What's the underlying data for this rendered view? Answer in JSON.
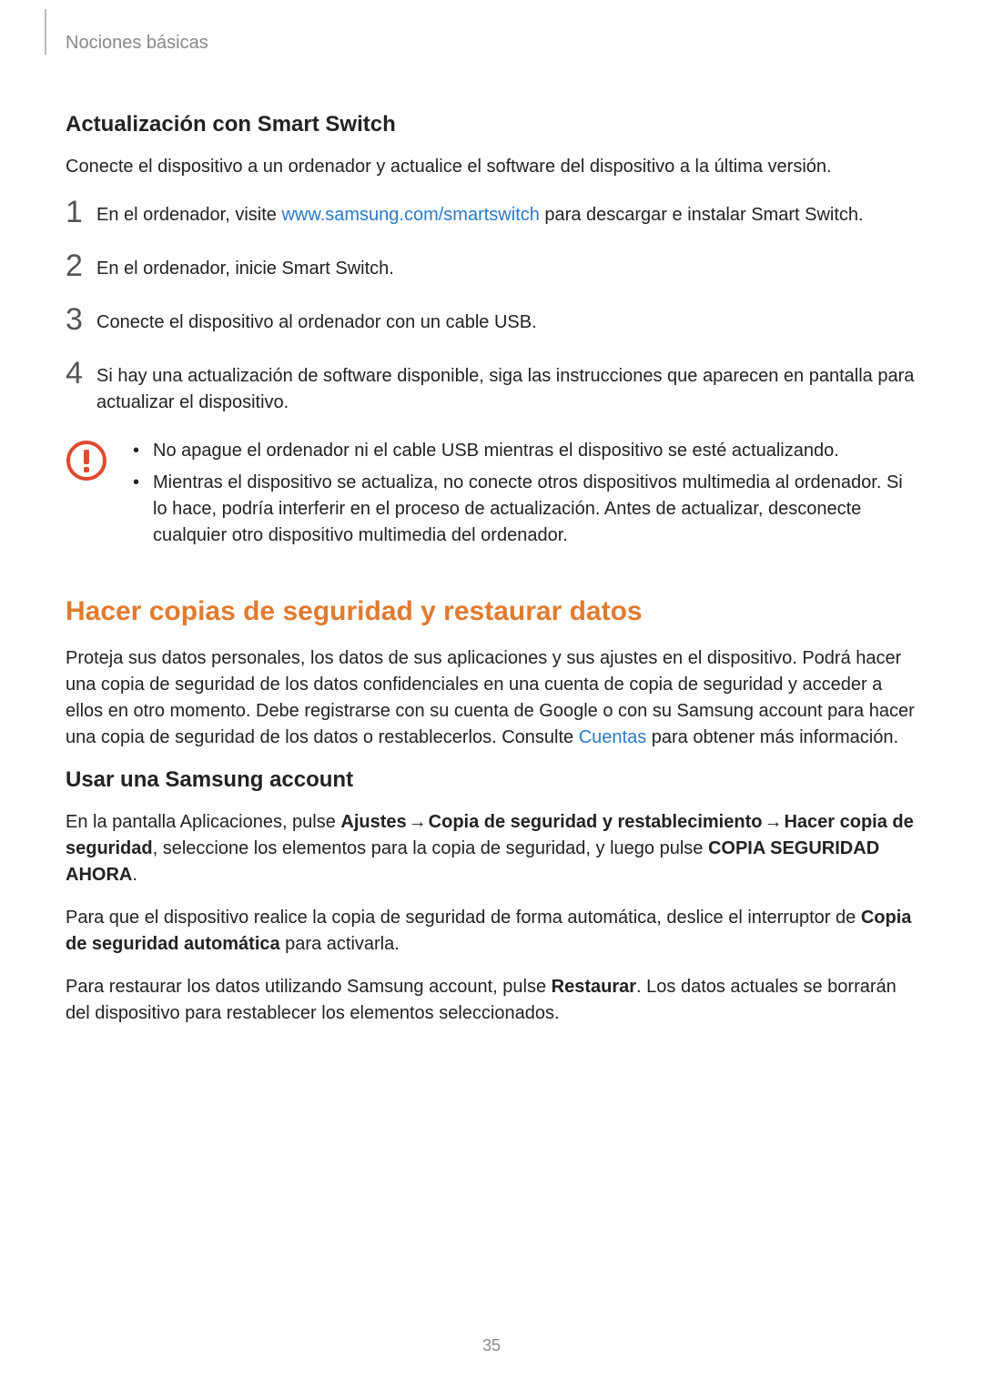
{
  "running_head": "Nociones básicas",
  "h_smart": "Actualización con Smart Switch",
  "p_smart_intro": "Conecte el dispositivo a un ordenador y actualice el software del dispositivo a la última versión.",
  "steps": {
    "n1": "1",
    "s1_a": "En el ordenador, visite ",
    "s1_link": "www.samsung.com/smartswitch",
    "s1_b": " para descargar e instalar Smart Switch.",
    "n2": "2",
    "s2": "En el ordenador, inicie Smart Switch.",
    "n3": "3",
    "s3": "Conecte el dispositivo al ordenador con un cable USB.",
    "n4": "4",
    "s4": "Si hay una actualización de software disponible, siga las instrucciones que aparecen en pantalla para actualizar el dispositivo."
  },
  "caution": {
    "b1": "No apague el ordenador ni el cable USB mientras el dispositivo se esté actualizando.",
    "b2": "Mientras el dispositivo se actualiza, no conecte otros dispositivos multimedia al ordenador. Si lo hace, podría interferir en el proceso de actualización. Antes de actualizar, desconecte cualquier otro dispositivo multimedia del ordenador."
  },
  "h_backup": "Hacer copias de seguridad y restaurar datos",
  "p_backup_a": "Proteja sus datos personales, los datos de sus aplicaciones y sus ajustes en el dispositivo. Podrá hacer una copia de seguridad de los datos confidenciales en una cuenta de copia de seguridad y acceder a ellos en otro momento. Debe registrarse con su cuenta de Google o con su Samsung account para hacer una copia de seguridad de los datos o restablecerlos. Consulte ",
  "p_backup_link": "Cuentas",
  "p_backup_b": " para obtener más información.",
  "h_samsung_acc": "Usar una Samsung account",
  "para_sa1": {
    "t1": "En la pantalla Aplicaciones, pulse ",
    "b1": "Ajustes",
    "arrow1": " → ",
    "b2": "Copia de seguridad y restablecimiento",
    "arrow2": " → ",
    "b3": "Hacer copia de seguridad",
    "t2": ", seleccione los elementos para la copia de seguridad, y luego pulse ",
    "b4": "COPIA SEGURIDAD AHORA",
    "t3": "."
  },
  "para_sa2": {
    "t1": "Para que el dispositivo realice la copia de seguridad de forma automática, deslice el interruptor de ",
    "b1": "Copia de seguridad automática",
    "t2": " para activarla."
  },
  "para_sa3": {
    "t1": "Para restaurar los datos utilizando Samsung account, pulse ",
    "b1": "Restaurar",
    "t2": ". Los datos actuales se borrarán del dispositivo para restablecer los elementos seleccionados."
  },
  "page_number": "35"
}
